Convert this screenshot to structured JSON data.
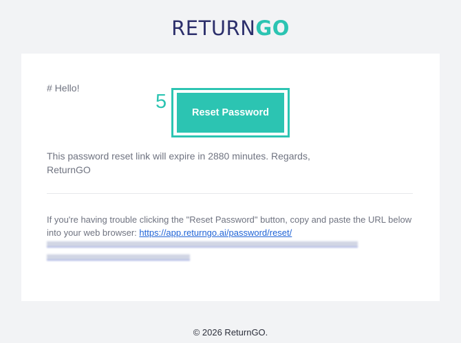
{
  "header": {
    "logo_part1": "RETURN",
    "logo_part2": "GO",
    "brand_colors": {
      "navy": "#2c2f6b",
      "teal": "#2cc4b2"
    }
  },
  "email": {
    "greeting": "# Hello!",
    "annotation_number": "5",
    "reset_button_label": "Reset Password",
    "expire_message": "This password reset link will expire in 2880 minutes. Regards, ReturnGO",
    "trouble_prefix": "If you're having trouble clicking the \"Reset Password\" button, copy and paste the URL below into your web browser: ",
    "reset_url_visible": "https://app.returngo.ai/password/reset/"
  },
  "footer": {
    "copyright": "© 2026 ReturnGO."
  }
}
